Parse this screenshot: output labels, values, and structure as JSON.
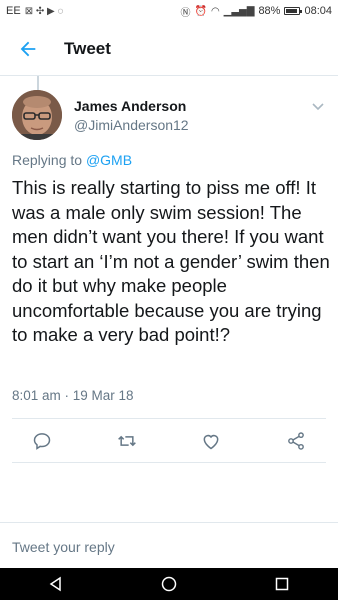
{
  "status_bar": {
    "carrier": "EE",
    "battery": "88%",
    "time": "08:04",
    "battery_level": 0.88
  },
  "header": {
    "title": "Tweet",
    "back_icon": "back-arrow-icon"
  },
  "tweet": {
    "author_name": "James Anderson",
    "author_handle": "@JimiAnderson12",
    "replying_prefix": "Replying to",
    "replying_to": "@GMB",
    "text": "This is really starting to piss me off! It was a male only swim session! The men didn’t want you there! If you want to start an ‘I’m not a gender’ swim then do it but why make people uncomfortable because you are trying to make a very bad point!?",
    "timestamp": "8:01 am · 19 Mar 18"
  },
  "actions": {
    "reply": "reply-icon",
    "retweet": "retweet-icon",
    "like": "like-icon",
    "share": "share-icon"
  },
  "reply_box": {
    "placeholder": "Tweet your reply"
  },
  "colors": {
    "accent": "#1da1f2",
    "text_primary": "#14171a",
    "text_secondary": "#657786",
    "divider": "#e1e8ed"
  }
}
